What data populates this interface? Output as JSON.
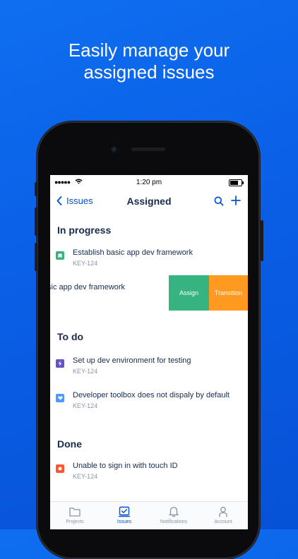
{
  "headline": {
    "line1": "Easily manage your",
    "line2": "assigned issues"
  },
  "status_bar": {
    "signal": "●●●●●",
    "time": "1:20 pm"
  },
  "nav": {
    "back_label": "Issues",
    "title": "Assigned"
  },
  "sections": [
    {
      "title": "In progress",
      "issues": [
        {
          "title": "Establish basic app dev framework",
          "key": "KEY-124",
          "type": "story",
          "color": "#36b37e"
        }
      ],
      "swiped_issue": {
        "title": "sic app dev framework",
        "actions": {
          "assign": "Assign",
          "transition": "Transition"
        }
      }
    },
    {
      "title": "To do",
      "issues": [
        {
          "title": "Set up dev environment for testing",
          "key": "KEY-124",
          "type": "epic",
          "color": "#6554c0"
        },
        {
          "title": "Developer toolbox does not dispaly by default",
          "key": "KEY-124",
          "type": "task",
          "color": "#4c9aff"
        }
      ]
    },
    {
      "title": "Done",
      "issues": [
        {
          "title": "Unable to sign in with touch ID",
          "key": "KEY-124",
          "type": "bug",
          "color": "#ff5630"
        }
      ]
    }
  ],
  "tabbar": [
    {
      "label": "Projects",
      "icon": "folder-icon",
      "active": false
    },
    {
      "label": "Issues",
      "icon": "issues-icon",
      "active": true
    },
    {
      "label": "Notifications",
      "icon": "bell-icon",
      "active": false
    },
    {
      "label": "Account",
      "icon": "person-icon",
      "active": false
    }
  ],
  "colors": {
    "background": "#0a5fe6",
    "accent": "#0052cc",
    "assign": "#36b37e",
    "transition": "#ff991f"
  }
}
